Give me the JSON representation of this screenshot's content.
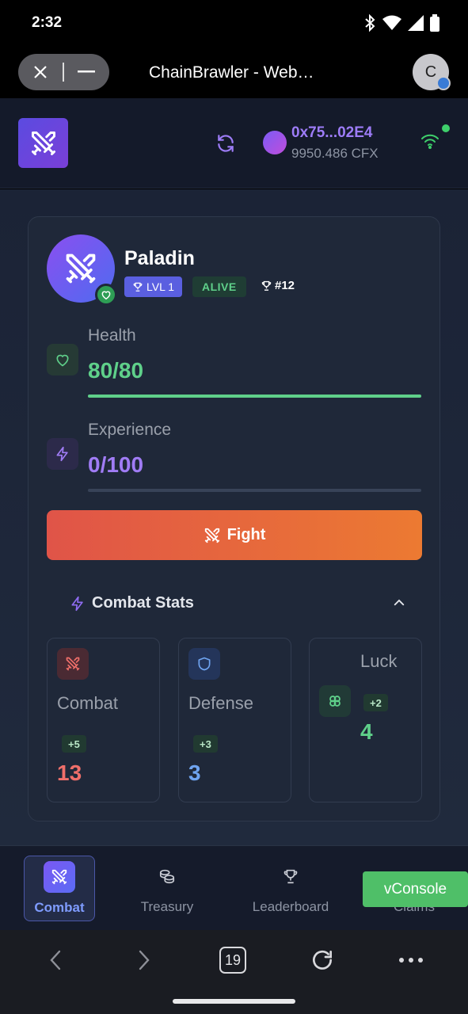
{
  "status": {
    "time": "2:32"
  },
  "browser": {
    "title": "ChainBrawler - Web…",
    "account_initial": "C",
    "tab_count": "19"
  },
  "header": {
    "wallet_address": "0x75...02E4",
    "wallet_balance": "9950.486 CFX"
  },
  "character": {
    "name": "Paladin",
    "level_label": "LVL 1",
    "status_label": "ALIVE",
    "rank_label": "#12",
    "health_label": "Health",
    "health_value": "80/80",
    "health_fraction": 1.0,
    "experience_label": "Experience",
    "experience_value": "0/100",
    "experience_fraction": 0.0,
    "fight_label": "Fight"
  },
  "combat_stats": {
    "heading": "Combat Stats",
    "tiles": [
      {
        "label": "Combat",
        "bonus": "+5",
        "value": "13"
      },
      {
        "label": "Defense",
        "bonus": "+3",
        "value": "3"
      },
      {
        "label": "Luck",
        "bonus": "+2",
        "value": "4"
      }
    ]
  },
  "bottom_nav": {
    "items": [
      {
        "label": "Combat"
      },
      {
        "label": "Treasury"
      },
      {
        "label": "Leaderboard"
      },
      {
        "label": "Claims"
      }
    ]
  },
  "vconsole": {
    "label": "vConsole"
  },
  "colors": {
    "accent": "#7b5cf5",
    "health": "#5fd08a",
    "experience": "#a07cf5",
    "combat": "#ef6f6a",
    "defense": "#6fa4f0",
    "luck": "#5fd08a",
    "fight_start": "#e05448",
    "fight_end": "#ec7a32"
  }
}
